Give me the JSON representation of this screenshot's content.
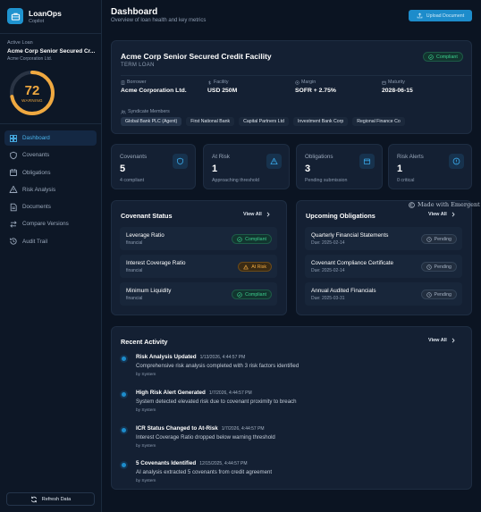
{
  "brand": {
    "name": "LoanOps",
    "subtitle": "Copilot"
  },
  "active_loan": {
    "label": "Active Loan",
    "name": "Acme Corp Senior Secured Cr...",
    "borrower": "Acme Corporation Ltd."
  },
  "gauge": {
    "value": "72",
    "level": 0.72,
    "status": "WARNING",
    "color": "#f0a940"
  },
  "nav": [
    {
      "label": "Dashboard",
      "icon": "grid-icon",
      "active": true
    },
    {
      "label": "Covenants",
      "icon": "shield-icon"
    },
    {
      "label": "Obligations",
      "icon": "calendar-icon"
    },
    {
      "label": "Risk Analysis",
      "icon": "warning-icon"
    },
    {
      "label": "Documents",
      "icon": "document-icon"
    },
    {
      "label": "Compare Versions",
      "icon": "compare-icon"
    },
    {
      "label": "Audit Trail",
      "icon": "history-icon"
    }
  ],
  "refresh_label": "Refresh Data",
  "header": {
    "title": "Dashboard",
    "subtitle": "Overview of loan health and key metrics",
    "upload_label": "Upload Document"
  },
  "facility": {
    "title": "Acme Corp Senior Secured Credit Facility",
    "type": "TERM LOAN",
    "status": "Compliant",
    "fields": [
      {
        "label": "Borrower",
        "value": "Acme Corporation Ltd.",
        "icon": "building-icon"
      },
      {
        "label": "Facility",
        "value": "USD 250M",
        "icon": "dollar-icon"
      },
      {
        "label": "Margin",
        "value": "SOFR + 2.75%",
        "icon": "percent-icon"
      },
      {
        "label": "Maturity",
        "value": "2028-06-15",
        "icon": "calendar-icon"
      }
    ],
    "syndicate_label": "Syndicate Members",
    "syndicate": [
      "Global Bank PLC (Agent)",
      "First National Bank",
      "Capital Partners Ltd",
      "Investment Bank Corp",
      "Regional Finance Co"
    ]
  },
  "stats": [
    {
      "label": "Covenants",
      "value": "5",
      "sub": "4 compliant",
      "icon": "shield-icon"
    },
    {
      "label": "At Risk",
      "value": "1",
      "sub": "Approaching threshold",
      "icon": "warning-icon"
    },
    {
      "label": "Obligations",
      "value": "3",
      "sub": "Pending submission",
      "icon": "calendar-icon"
    },
    {
      "label": "Risk Alerts",
      "value": "1",
      "sub": "0 critical",
      "icon": "alert-circle-icon"
    }
  ],
  "covenant_status": {
    "title": "Covenant Status",
    "view_all": "View All",
    "items": [
      {
        "name": "Leverage Ratio",
        "category": "financial",
        "status": "Compliant"
      },
      {
        "name": "Interest Coverage Ratio",
        "category": "financial",
        "status": "At Risk"
      },
      {
        "name": "Minimum Liquidity",
        "category": "financial",
        "status": "Compliant"
      }
    ]
  },
  "obligations": {
    "title": "Upcoming Obligations",
    "view_all": "View All",
    "items": [
      {
        "name": "Quarterly Financial Statements",
        "due": "Due: 2025-02-14",
        "status": "Pending"
      },
      {
        "name": "Covenant Compliance Certificate",
        "due": "Due: 2025-02-14",
        "status": "Pending"
      },
      {
        "name": "Annual Audited Financials",
        "due": "Due: 2025-03-31",
        "status": "Pending"
      }
    ]
  },
  "activity": {
    "title": "Recent Activity",
    "view_all": "View All",
    "items": [
      {
        "title": "Risk Analysis Updated",
        "time": "1/13/2026, 4:44:57 PM",
        "desc": "Comprehensive risk analysis completed with 3 risk factors identified",
        "by": "by System"
      },
      {
        "title": "High Risk Alert Generated",
        "time": "1/7/2026, 4:44:57 PM",
        "desc": "System detected elevated risk due to covenant proximity to breach",
        "by": "by System"
      },
      {
        "title": "ICR Status Changed to At-Risk",
        "time": "1/7/2026, 4:44:57 PM",
        "desc": "Interest Coverage Ratio dropped below warning threshold",
        "by": "by System"
      },
      {
        "title": "5 Covenants Identified",
        "time": "12/15/2025, 4:44:57 PM",
        "desc": "AI analysis extracted 5 covenants from credit agreement",
        "by": "by System"
      }
    ]
  },
  "watermark": "Made with Emergent"
}
